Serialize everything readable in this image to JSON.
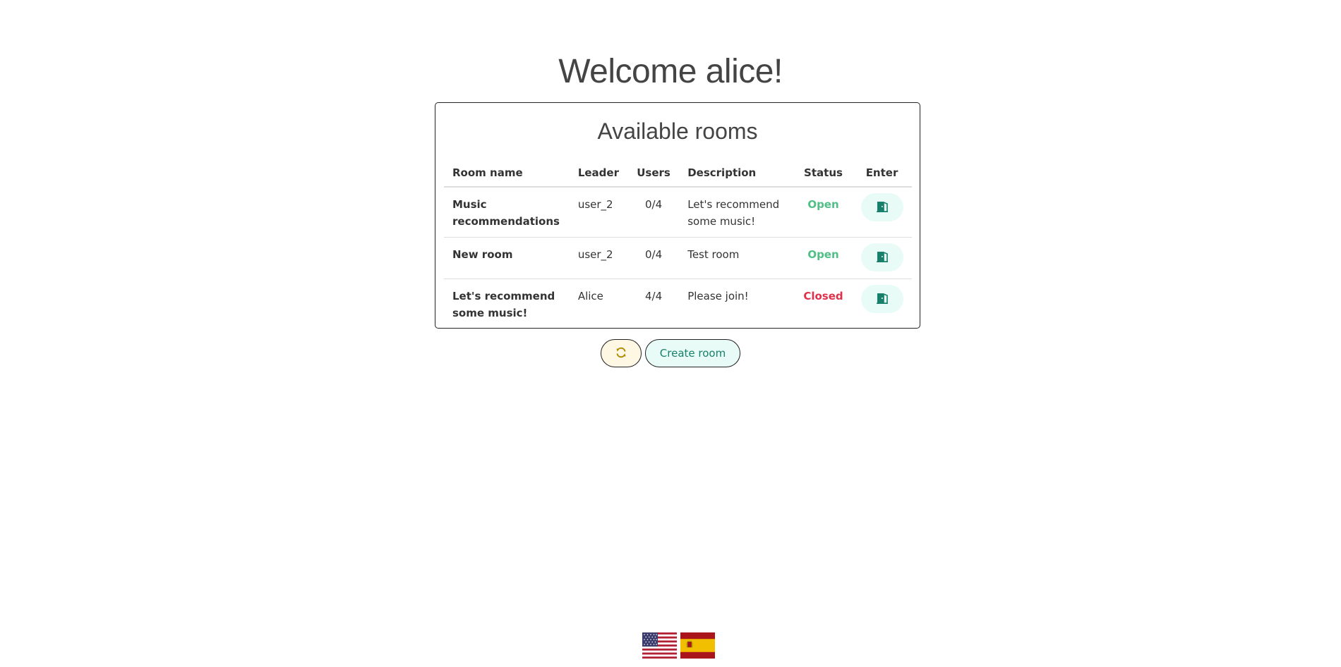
{
  "welcome": "Welcome alice!",
  "rooms_panel": {
    "title": "Available rooms",
    "columns": [
      "Room name",
      "Leader",
      "Users",
      "Description",
      "Status",
      "Enter"
    ],
    "rows": [
      {
        "name": "Music recommendations",
        "leader": "user_2",
        "users": "0/4",
        "description": "Let's recommend some music!",
        "status": "Open"
      },
      {
        "name": "New room",
        "leader": "user_2",
        "users": "0/4",
        "description": "Test room",
        "status": "Open"
      },
      {
        "name": "Let's recommend some music!",
        "leader": "Alice",
        "users": "4/4",
        "description": "Please join!",
        "status": "Closed"
      }
    ],
    "enter_icon": "door-icon"
  },
  "actions": {
    "refresh_icon": "refresh-icon",
    "create_label": "Create room"
  },
  "languages": [
    {
      "icon": "us-flag-icon"
    },
    {
      "icon": "spain-flag-icon"
    }
  ],
  "colors": {
    "open": "#4fbf85",
    "closed": "#e0314b",
    "teal": "#17806b",
    "yellow": "#b08a00"
  }
}
